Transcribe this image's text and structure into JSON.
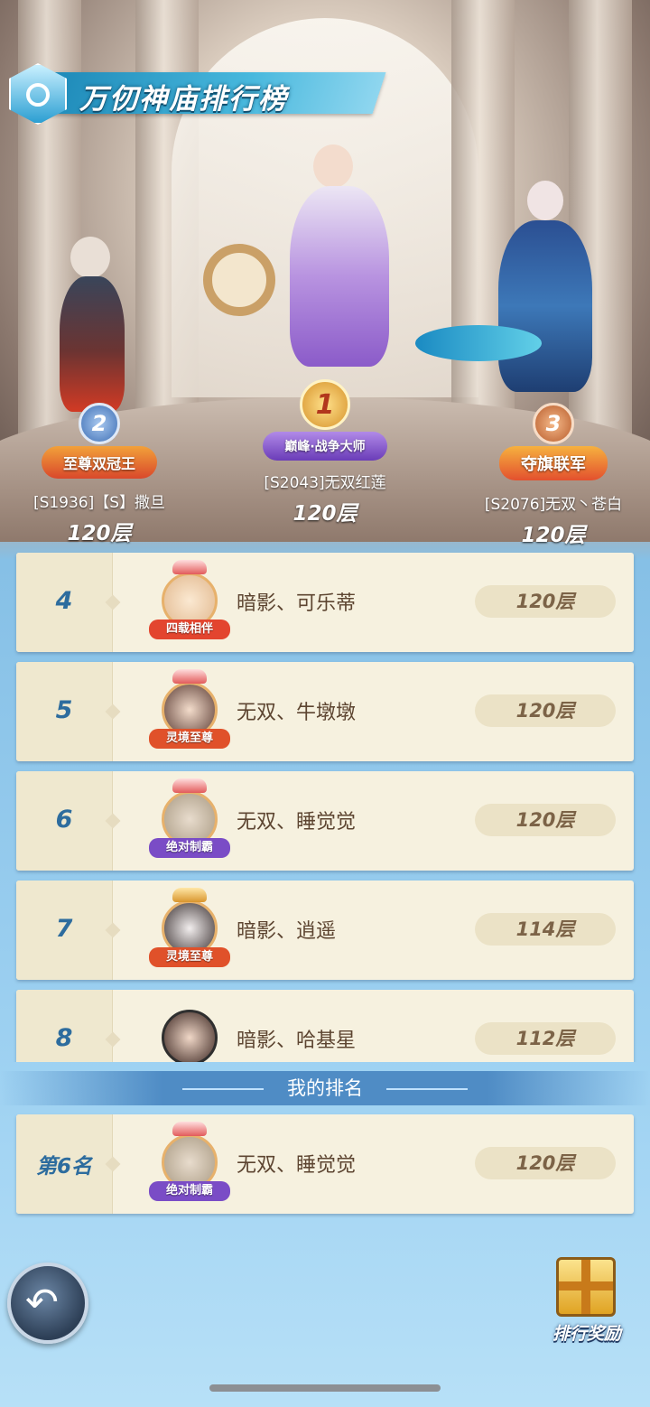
{
  "header": {
    "title": "万仞神庙排行榜"
  },
  "podium": [
    {
      "rank": "2",
      "title": "至尊双冠王",
      "name": "[S1936]【S】撒旦",
      "floor": "120层",
      "badge_color": "#d9482b"
    },
    {
      "rank": "1",
      "title": "巅峰·战争大师",
      "name": "[S2043]无双红莲",
      "floor": "120层",
      "badge_color": "#8d5bd0"
    },
    {
      "rank": "3",
      "title": "夺旗联军",
      "name": "[S2076]无双丶苍白",
      "floor": "120层",
      "badge_color": "#e3502e"
    }
  ],
  "ranking": [
    {
      "rank": "4",
      "name": "暗影、可乐蒂",
      "floor": "120层",
      "frame_tag": "四载相伴",
      "tag_color": "#e3452f"
    },
    {
      "rank": "5",
      "name": "无双、牛墩墩",
      "floor": "120层",
      "frame_tag": "灵境至尊",
      "tag_color": "#e0512a"
    },
    {
      "rank": "6",
      "name": "无双、睡觉觉",
      "floor": "120层",
      "frame_tag": "绝对制霸",
      "tag_color": "#7a4cc6"
    },
    {
      "rank": "7",
      "name": "暗影、逍遥",
      "floor": "114层",
      "frame_tag": "灵境至尊",
      "tag_color": "#e0512a"
    },
    {
      "rank": "8",
      "name": "暗影、哈基星",
      "floor": "112层",
      "frame_tag": "",
      "tag_color": "#e0512a"
    }
  ],
  "my_rank": {
    "header": "我的排名",
    "rank": "第6名",
    "name": "无双、睡觉觉",
    "floor": "120层",
    "frame_tag": "绝对制霸"
  },
  "controls": {
    "reward_label": "排行奖励"
  },
  "colors": {
    "accent": "#2d6c9e",
    "row_bg": "#f6f1df",
    "floor_pill": "#ebe2c6"
  }
}
